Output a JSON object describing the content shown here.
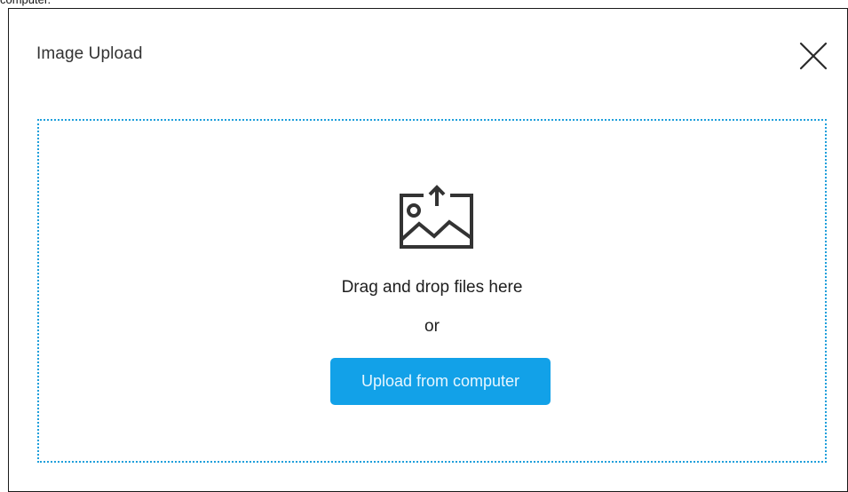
{
  "top_clipped_text": "computer.",
  "dialog": {
    "title": "Image Upload",
    "close_icon": "close-icon"
  },
  "dropzone": {
    "icon": "image-upload-icon",
    "instruction": "Drag and drop files here",
    "separator": "or",
    "upload_button_label": "Upload from computer"
  },
  "colors": {
    "accent": "#12a1e8",
    "dropzone_border": "#1f9fdb",
    "button_text": "#e6f6ff"
  }
}
